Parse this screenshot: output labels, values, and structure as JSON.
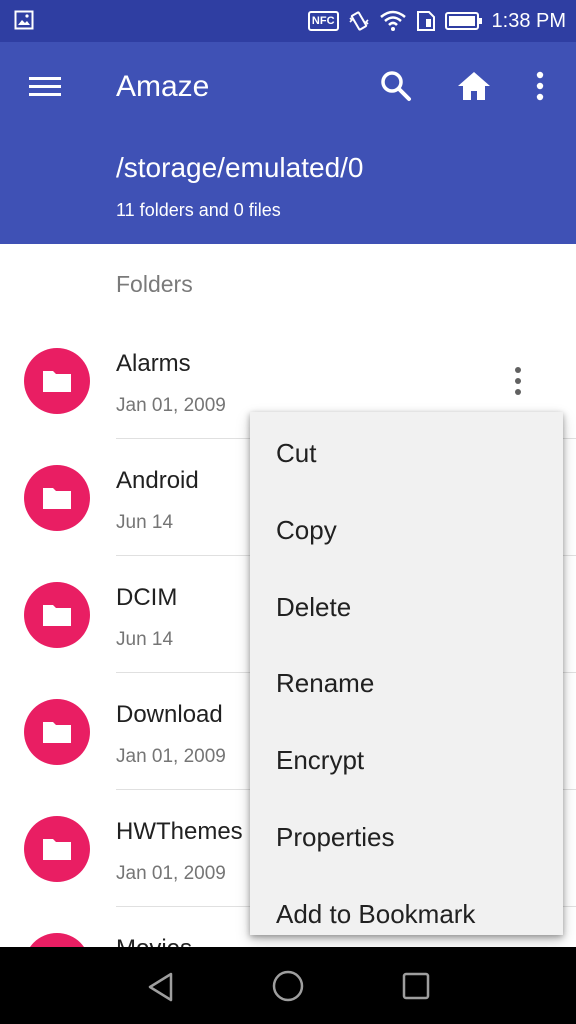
{
  "status_bar": {
    "time": "1:38 PM",
    "nfc_label": "NFC",
    "icons": [
      "gallery-icon",
      "nfc-icon",
      "vibrate-icon",
      "wifi-icon",
      "sim-icon",
      "battery-icon"
    ]
  },
  "app_bar": {
    "title": "Amaze",
    "path": "/storage/emulated/0",
    "count": "11 folders and 0 files",
    "icons": [
      "menu-icon",
      "search-icon",
      "home-icon",
      "overflow-icon"
    ],
    "color": "#3f51b5",
    "status_color": "#2f3ea2"
  },
  "section": {
    "label": "Folders"
  },
  "folders": [
    {
      "name": "Alarms",
      "date": "Jan 01, 2009"
    },
    {
      "name": "Android",
      "date": "Jun 14"
    },
    {
      "name": "DCIM",
      "date": "Jun 14"
    },
    {
      "name": "Download",
      "date": "Jan 01, 2009"
    },
    {
      "name": "HWThemes",
      "date": "Jan 01, 2009"
    },
    {
      "name": "Movies",
      "date": ""
    }
  ],
  "folder_icon_color": "#e91e63",
  "context_menu": {
    "items": [
      "Cut",
      "Copy",
      "Delete",
      "Rename",
      "Encrypt",
      "Properties",
      "Add to Bookmark"
    ]
  },
  "nav_bar": {
    "icons": [
      "back-icon",
      "home-circle-icon",
      "recents-icon"
    ]
  }
}
